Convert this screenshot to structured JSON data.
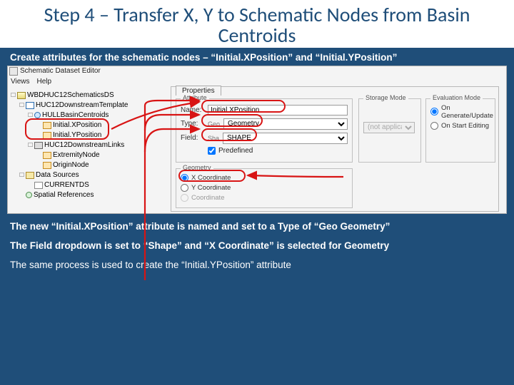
{
  "heading": "Step 4 – Transfer X, Y to Schematic Nodes from Basin Centroids",
  "caption_top": "Create attributes for the schematic nodes – “Initial.XPosition” and “Initial.YPosition”",
  "editor": {
    "title": "Schematic Dataset Editor",
    "menu": {
      "views": "Views",
      "help": "Help"
    },
    "tree": {
      "root": "WBDHUC12SchematicsDS",
      "template": "HUC12DownstreamTemplate",
      "node_class": "HULLBasinCentroids",
      "attr_x": "Initial.XPosition",
      "attr_y": "Initial.YPosition",
      "link_class": "HUC12DownstreamLinks",
      "link_ext": "ExtremityNode",
      "link_org": "OriginNode",
      "data_sources": "Data Sources",
      "ds_item": "CURRENTDS",
      "spatial_ref": "Spatial References"
    }
  },
  "props": {
    "tab": "Properties",
    "groups": {
      "attribute": "Attribute",
      "storage": "Storage Mode",
      "evaluation": "Evaluation Mode",
      "geometry": "Geometry"
    },
    "labels": {
      "name": "Name:",
      "type": "Type:",
      "field": "Field:",
      "predefined": "Predefined",
      "not_applicable": "(not applicable)",
      "on_generate": "On Generate/Update",
      "on_start": "On Start Editing",
      "x_coord": "X Coordinate",
      "y_coord": "Y Coordinate",
      "coord": "Coordinate"
    },
    "values": {
      "name": "Initial.XPosition",
      "type": "Geometry",
      "field": "SHAPE"
    },
    "type_prefix": "Geo",
    "field_prefix": "Sha"
  },
  "body": {
    "line1": "The new “Initial.XPosition” attribute is named and set to a Type of “Geo Geometry”",
    "line2": "The Field dropdown is set to “Shape” and “X Coordinate” is selected for Geometry",
    "line3": "The same process is used to create the “Initial.YPosition” attribute"
  }
}
